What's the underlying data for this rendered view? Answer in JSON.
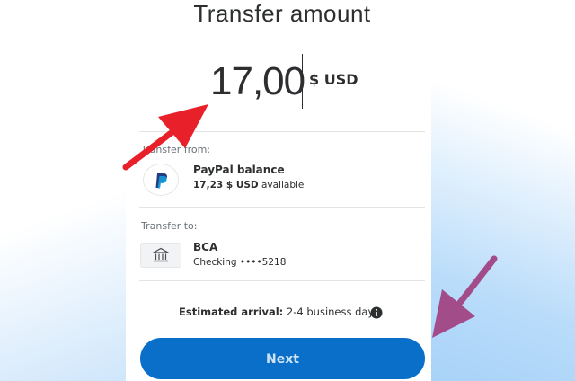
{
  "title": "Transfer amount",
  "amount": {
    "value": "17,00",
    "currency": "$ USD"
  },
  "transfer_from": {
    "label": "Transfer from:",
    "source_name": "PayPal balance",
    "balance_amount": "17,23 $ USD",
    "balance_suffix": " available",
    "icon": "paypal-logo-icon"
  },
  "transfer_to": {
    "label": "Transfer to:",
    "bank_name": "BCA",
    "account": "Checking ••••5218",
    "icon": "bank-icon"
  },
  "arrival": {
    "label": "Estimated arrival:",
    "value": " 2-4 business days",
    "icon": "info-icon"
  },
  "next_button": {
    "label": "Next"
  },
  "colors": {
    "button": "#0a6fc9",
    "button_text": "#cfe3f7",
    "arrow_red": "#e8202a",
    "arrow_purple": "#a24d8a",
    "paypal_dark": "#253b80",
    "paypal_light": "#179bd7"
  }
}
